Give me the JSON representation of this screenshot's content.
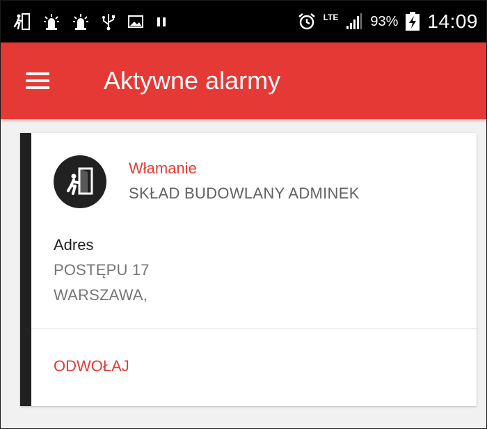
{
  "status_bar": {
    "left_icons": [
      "running-man-notification-icon",
      "siren-notification-icon",
      "siren-notification-icon",
      "usb-icon",
      "image-icon",
      "pause-icon"
    ],
    "lte_label": "LTE",
    "battery_percent": "93%",
    "battery_level": 0.93,
    "time": "14:09"
  },
  "app_bar": {
    "title": "Aktywne alarmy",
    "color": "#e53935",
    "menu_icon": "hamburger-menu-icon"
  },
  "alarm_card": {
    "stripe_color": "#212121",
    "icon": "intruder-door-icon",
    "type": "Włamanie",
    "object_name": "SKŁAD BUDOWLANY ADMINEK",
    "address_label": "Adres",
    "address_line_1": "POSTĘPU 17",
    "address_line_2": "WARSZAWA,",
    "cancel_label": "ODWOŁAJ"
  }
}
